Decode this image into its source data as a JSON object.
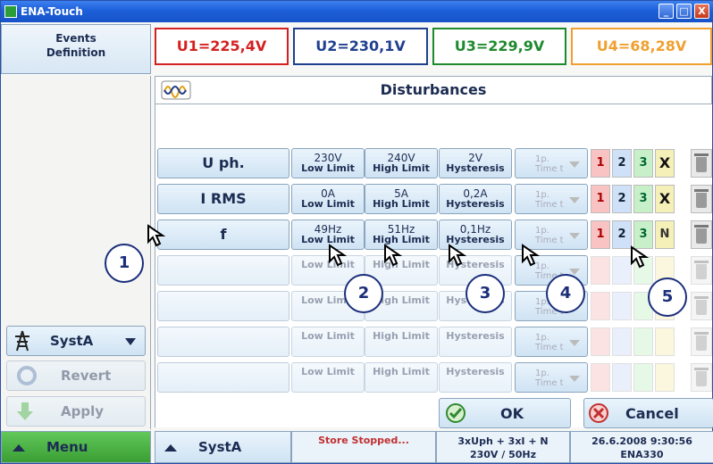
{
  "window": {
    "title": "ENA-Touch",
    "minimize": "_",
    "maximize": "□",
    "close": "X"
  },
  "left": {
    "events_label": "Events Definition",
    "system_select": "SystA",
    "revert_label": "Revert",
    "apply_label": "Apply",
    "menu_label": "Menu"
  },
  "voltages": {
    "u1": "U1=225,4V",
    "u2": "U2=230,1V",
    "u3": "U3=229,9V",
    "u4": "U4=68,28V"
  },
  "panel": {
    "title": "Disturbances"
  },
  "rows": [
    {
      "label": "U ph.",
      "low_val": "230V",
      "low_lbl": "Low Limit",
      "high_val": "240V",
      "high_lbl": "High Limit",
      "hyst_val": "2V",
      "hyst_lbl": "Hysteresis",
      "time_val": "1p.",
      "time_lbl": "Time t",
      "phases": [
        "1",
        "2",
        "3",
        "X"
      ]
    },
    {
      "label": "I RMS",
      "low_val": "0A",
      "low_lbl": "Low Limit",
      "high_val": "5A",
      "high_lbl": "High Limit",
      "hyst_val": "0,2A",
      "hyst_lbl": "Hysteresis",
      "time_val": "1p.",
      "time_lbl": "Time t",
      "phases": [
        "1",
        "2",
        "3",
        "X"
      ]
    },
    {
      "label": "f",
      "low_val": "49Hz",
      "low_lbl": "Low Limit",
      "high_val": "51Hz",
      "high_lbl": "High Limit",
      "hyst_val": "0,1Hz",
      "hyst_lbl": "Hysteresis",
      "time_val": "1p.",
      "time_lbl": "Time t",
      "phases": [
        "1",
        "2",
        "3",
        "N"
      ]
    },
    {
      "label": "",
      "low_val": "",
      "low_lbl": "Low Limit",
      "high_val": "",
      "high_lbl": "High Limit",
      "hyst_val": "",
      "hyst_lbl": "Hysteresis",
      "time_val": "1p.",
      "time_lbl": "Time t"
    },
    {
      "label": "",
      "low_val": "",
      "low_lbl": "Low Limit",
      "high_val": "",
      "high_lbl": "High Limit",
      "hyst_val": "",
      "hyst_lbl": "Hysteresis",
      "time_val": "1p.",
      "time_lbl": "Time t"
    },
    {
      "label": "",
      "low_val": "",
      "low_lbl": "Low Limit",
      "high_val": "",
      "high_lbl": "High Limit",
      "hyst_val": "",
      "hyst_lbl": "Hysteresis",
      "time_val": "1p.",
      "time_lbl": "Time t"
    },
    {
      "label": "",
      "low_val": "",
      "low_lbl": "Low Limit",
      "high_val": "",
      "high_lbl": "High Limit",
      "hyst_val": "",
      "hyst_lbl": "Hysteresis",
      "time_val": "1p.",
      "time_lbl": "Time t"
    }
  ],
  "callouts": [
    "1",
    "2",
    "3",
    "4",
    "5"
  ],
  "actions": {
    "ok": "OK",
    "cancel": "Cancel"
  },
  "status": {
    "system": "SystA",
    "store": "Store Stopped...",
    "conn1": "3xUph + 3xI + N",
    "conn2": "230V / 50Hz",
    "date": "26.6.2008 9:30:56",
    "device": "ENA330"
  },
  "colors": {
    "u1": "#d42020",
    "u2": "#1f3f8f",
    "u3": "#1e8a2e",
    "u4": "#f0a030",
    "accent": "#1d5fd8"
  }
}
